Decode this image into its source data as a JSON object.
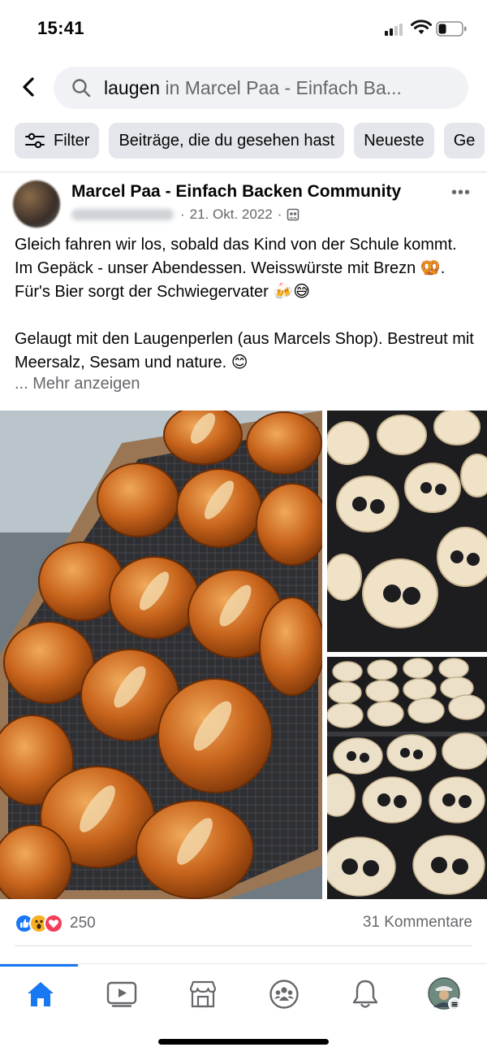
{
  "status_bar": {
    "time": "15:41"
  },
  "search": {
    "query": "laugen",
    "scope": "in Marcel Paa - Einfach Ba..."
  },
  "filters": [
    "Filter",
    "Beiträge, die du gesehen hast",
    "Neueste",
    "Ge"
  ],
  "post": {
    "group_name": "Marcel Paa - Einfach Backen Community",
    "date": "21. Okt. 2022",
    "separator": "·",
    "paragraphs": [
      "Gleich fahren wir los, sobald das Kind von der Schule kommt. Im Gepäck - unser Abendessen. Weisswürste mit Brezn 🥨. Für's Bier sorgt der Schwiegervater 🍻😅",
      "Gelaugt mit den Laugenperlen (aus Marcels Shop). Bestreut mit Meersalz, Sesam und nature. 😊"
    ],
    "see_more": "... Mehr anzeigen",
    "photos": [
      "pretzels-on-tray",
      "raw-pretzels-on-tray",
      "raw-pretzels-rows"
    ]
  },
  "engagement": {
    "reaction_count": "250",
    "comments": "31 Kommentare",
    "reactions": [
      "like",
      "wow",
      "love"
    ]
  },
  "tab_bar": {
    "tabs": [
      "home-icon",
      "video-icon",
      "marketplace-icon",
      "groups-icon",
      "notifications-icon",
      "profile-avatar"
    ],
    "active": "home-icon",
    "accent": "#1877f2"
  }
}
